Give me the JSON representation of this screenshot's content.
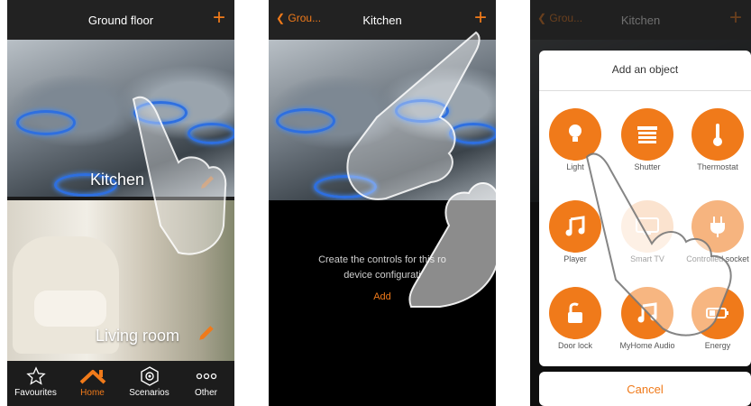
{
  "colors": {
    "accent": "#f07a1a",
    "topbar": "#222222",
    "nav_bg": "#1c1c1c"
  },
  "screen1": {
    "title": "Ground floor",
    "add_icon": "+",
    "rooms": [
      {
        "name": "Kitchen",
        "edit_icon": "pencil-icon"
      },
      {
        "name": "Living room",
        "edit_icon": "pencil-icon"
      }
    ],
    "nav": [
      {
        "label": "Favourites",
        "icon": "star-icon"
      },
      {
        "label": "Home",
        "icon": "home-icon",
        "active": true
      },
      {
        "label": "Scenarios",
        "icon": "scenario-icon"
      },
      {
        "label": "Other",
        "icon": "more-icon"
      }
    ]
  },
  "screen2": {
    "back_label": "Grou...",
    "title": "Kitchen",
    "add_icon": "+",
    "message_line1": "Create the controls for this ro",
    "message_line2": "device configurati",
    "add_link": "Add"
  },
  "screen3": {
    "back_label": "Grou...",
    "title": "Kitchen",
    "add_icon": "+",
    "panel_title": "Add an object",
    "objects": [
      {
        "label": "Light",
        "icon": "bulb-icon"
      },
      {
        "label": "Shutter",
        "icon": "shutter-icon"
      },
      {
        "label": "Thermostat",
        "icon": "thermometer-icon"
      },
      {
        "label": "Player",
        "icon": "music-note-icon"
      },
      {
        "label": "Smart TV",
        "icon": "tv-icon"
      },
      {
        "label": "Controlled socket",
        "icon": "plug-icon"
      },
      {
        "label": "Door lock",
        "icon": "padlock-icon"
      },
      {
        "label": "MyHome Audio",
        "icon": "music-note-icon"
      },
      {
        "label": "Energy",
        "icon": "battery-icon"
      }
    ],
    "cancel_label": "Cancel"
  }
}
